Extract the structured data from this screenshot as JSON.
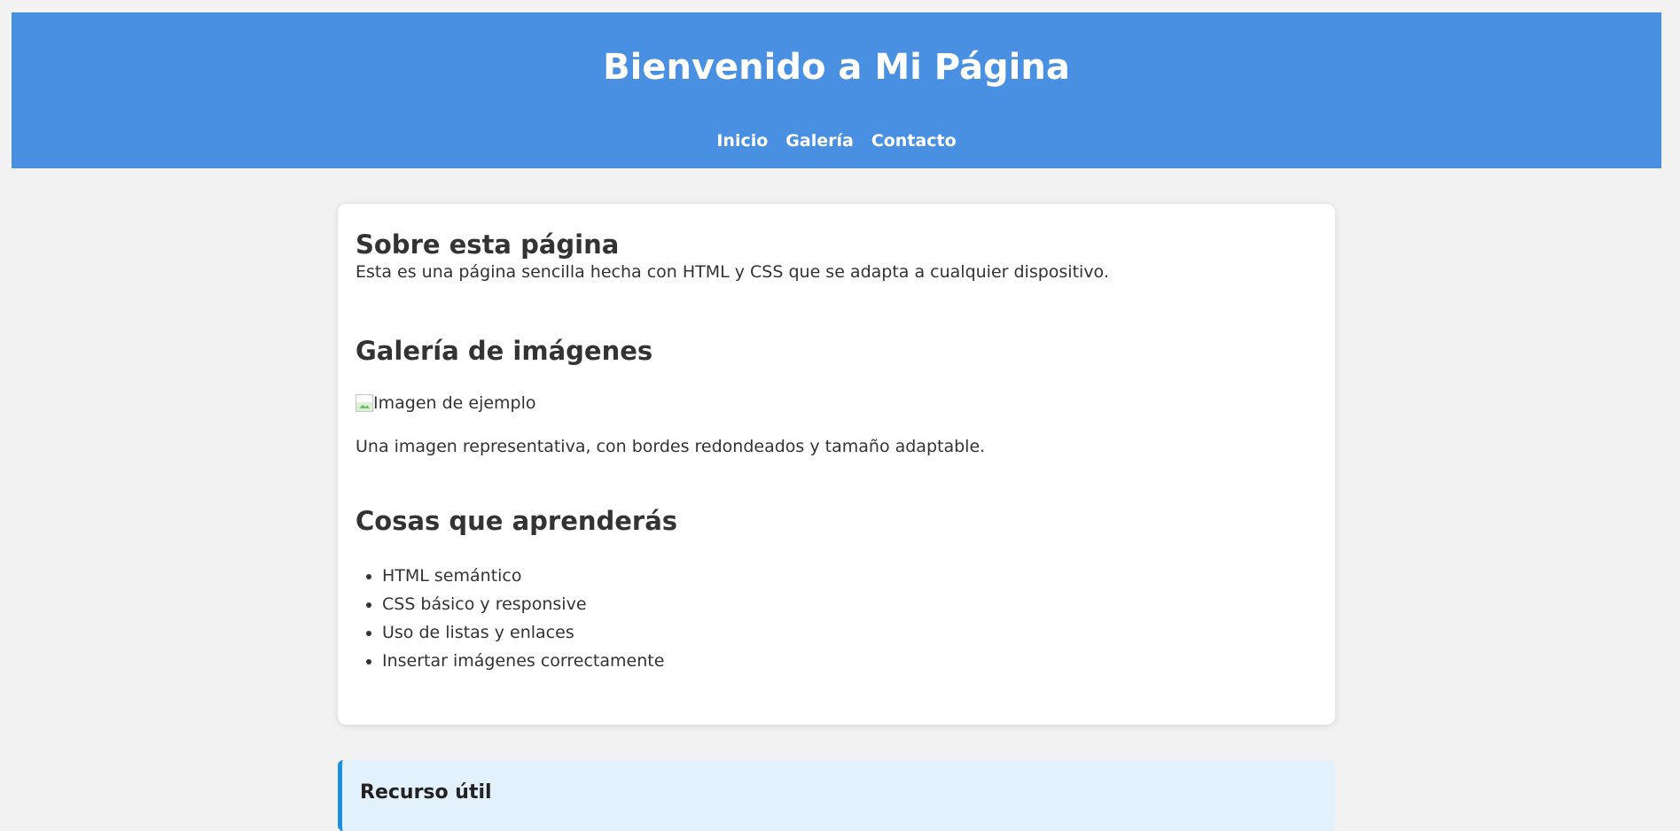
{
  "header": {
    "title": "Bienvenido a Mi Página",
    "nav": [
      {
        "label": "Inicio"
      },
      {
        "label": "Galería"
      },
      {
        "label": "Contacto"
      }
    ]
  },
  "about": {
    "title": "Sobre esta página",
    "text": "Esta es una página sencilla hecha con HTML y CSS que se adapta a cualquier dispositivo."
  },
  "gallery": {
    "title": "Galería de imágenes",
    "image_alt": "Imagen de ejemplo",
    "caption": "Una imagen representativa, con bordes redondeados y tamaño adaptable."
  },
  "learn": {
    "title": "Cosas que aprenderás",
    "items": [
      "HTML semántico",
      "CSS básico y responsive",
      "Uso de listas y enlaces",
      "Insertar imágenes correctamente"
    ]
  },
  "resource": {
    "title": "Recurso útil"
  },
  "colors": {
    "header_background": "#4a90e2",
    "page_background": "#f2f2f2",
    "resource_background": "#e3f1fc",
    "resource_border": "#1f8de0"
  }
}
